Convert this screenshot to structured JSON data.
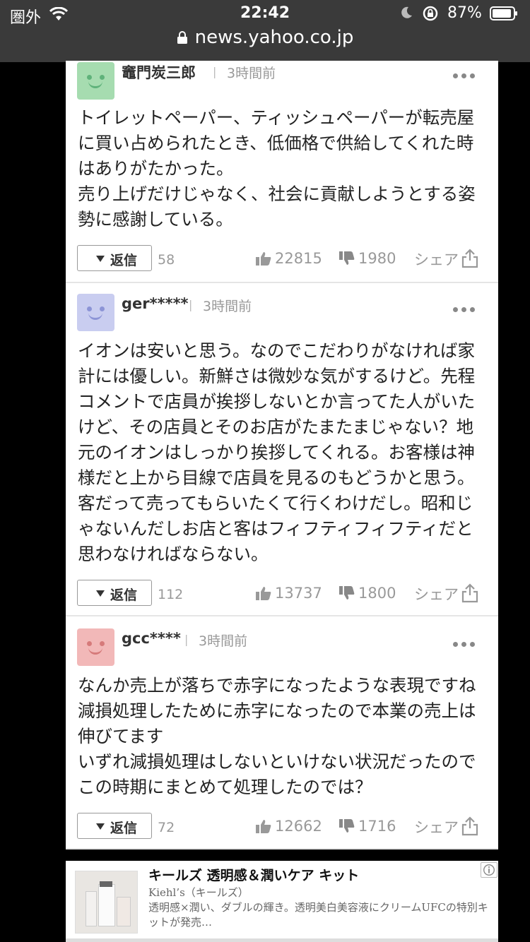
{
  "status_bar": {
    "carrier": "圏外",
    "time": "22:42",
    "battery": "87%"
  },
  "browser": {
    "url": "news.yahoo.co.jp"
  },
  "comments": [
    {
      "user": "竈門炭三郎",
      "time": "3時間前",
      "avatar_color": "#a6dcb0",
      "body": "トイレットペーパー、ティッシュペーパーが転売屋に買い占められたとき、低価格で供給してくれた時はありがたかった。\n売り上げだけじゃなく、社会に貢献しようとする姿勢に感謝している。",
      "reply_label": "返信",
      "reply_count": "58",
      "likes": "22815",
      "dislikes": "1980",
      "share_label": "シェア"
    },
    {
      "user": "ger*****",
      "time": "3時間前",
      "avatar_color": "#c9cdf0",
      "body": "イオンは安いと思う。なのでこだわりがなければ家計には優しい。新鮮さは微妙な気がするけど。先程コメントで店員が挨拶しないとか言ってた人がいたけど、その店員とそのお店がたまたまじゃない？地元のイオンはしっかり挨拶してくれる。お客様は神様だと上から目線で店員を見るのもどうかと思う。客だって売ってもらいたくて行くわけだし。昭和じゃないんだしお店と客はフィフティフィフティだと思わなければならない。",
      "reply_label": "返信",
      "reply_count": "112",
      "likes": "13737",
      "dislikes": "1800",
      "share_label": "シェア"
    },
    {
      "user": "gcc****",
      "time": "3時間前",
      "avatar_color": "#f2b8b8",
      "body": "なんか売上が落ちで赤字になったような表現ですね\n減損処理したために赤字になったので本業の売上は伸びてます\nいずれ減損処理はしないといけない状況だったのでこの時期にまとめて処理したのでは？",
      "reply_label": "返信",
      "reply_count": "72",
      "likes": "12662",
      "dislikes": "1716",
      "share_label": "シェア"
    }
  ],
  "ad": {
    "title": "キールズ 透明感＆潤いケア キット",
    "brand": "Kiehl’s（キールズ）",
    "description": "透明感×潤い、ダブルの輝き。透明美白美容液にクリームUFCの特別キットが発売…"
  }
}
